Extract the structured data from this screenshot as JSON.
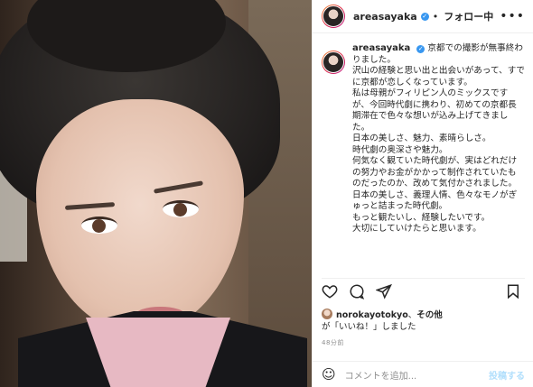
{
  "header": {
    "username": "areasayaka",
    "follow_status": "フォロー中",
    "more_icon": "ellipsis-icon"
  },
  "caption": {
    "username": "areasayaka",
    "lines": [
      "京都での撮影が無事終わりました。",
      "沢山の経験と思い出と出会いがあって、すでに京都が恋しくなっています。",
      "私は母親がフィリピン人のミックスですが、今回時代劇に携わり、初めての京都長期滞在で色々な想いが込み上げてきました。",
      "日本の美しさ、魅力、素晴らしさ。",
      "時代劇の奥深さや魅力。",
      "何気なく観ていた時代劇が、実はどれだけの努力やお金がかかって制作されていたものだったのか、改めて気付かされました。",
      "日本の美しさ、義理人情、色々なモノがぎゅっと詰まった時代劇。",
      "もっと観たいし、経験したいです。",
      "大切にしていけたらと思います。"
    ]
  },
  "likes": {
    "user": "norokayotokyo",
    "sep": "、",
    "others": "その他",
    "suffix": "が「いいね！」しました"
  },
  "time": "48分前",
  "comment": {
    "placeholder": "コメントを追加...",
    "post_label": "投稿する"
  },
  "colors": {
    "verified": "#3897f0",
    "post_disabled": "#b2dffc"
  }
}
